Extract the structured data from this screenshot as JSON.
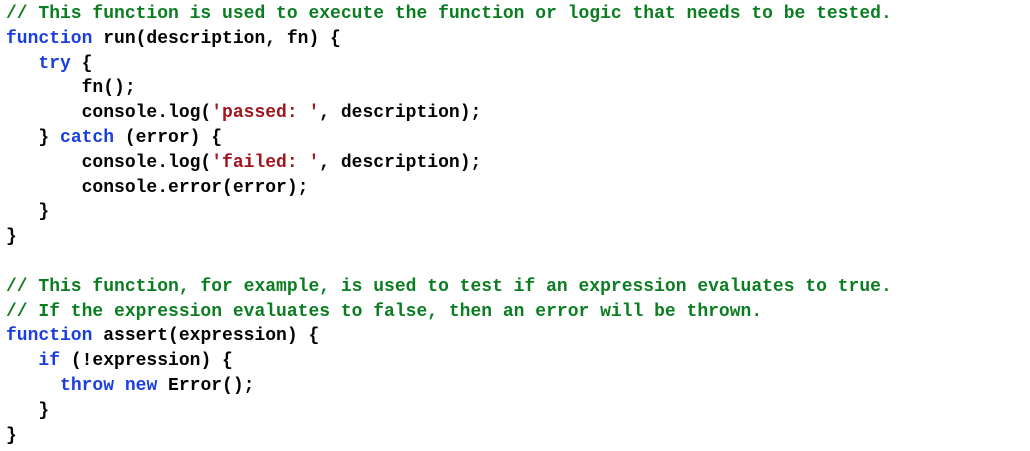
{
  "colors": {
    "comment": "#0a7d20",
    "keyword": "#1a3ee0",
    "string": "#a0141c",
    "text": "#000000",
    "background": "#ffffff"
  },
  "code": {
    "lines": [
      [
        {
          "t": "comment",
          "v": "// This function is used to execute the function or logic that needs to be tested."
        }
      ],
      [
        {
          "t": "keyword",
          "v": "function"
        },
        {
          "t": "plain",
          "v": " run(description, fn) {"
        }
      ],
      [
        {
          "t": "plain",
          "v": "   "
        },
        {
          "t": "keyword",
          "v": "try"
        },
        {
          "t": "plain",
          "v": " {"
        }
      ],
      [
        {
          "t": "plain",
          "v": "       fn();"
        }
      ],
      [
        {
          "t": "plain",
          "v": "       console.log("
        },
        {
          "t": "string",
          "v": "'passed: '"
        },
        {
          "t": "plain",
          "v": ", description);"
        }
      ],
      [
        {
          "t": "plain",
          "v": "   } "
        },
        {
          "t": "keyword",
          "v": "catch"
        },
        {
          "t": "plain",
          "v": " (error) {"
        }
      ],
      [
        {
          "t": "plain",
          "v": "       console.log("
        },
        {
          "t": "string",
          "v": "'failed: '"
        },
        {
          "t": "plain",
          "v": ", description);"
        }
      ],
      [
        {
          "t": "plain",
          "v": "       console.error(error);"
        }
      ],
      [
        {
          "t": "plain",
          "v": "   }"
        }
      ],
      [
        {
          "t": "plain",
          "v": "}"
        }
      ],
      [],
      [
        {
          "t": "comment",
          "v": "// This function, for example, is used to test if an expression evaluates to true."
        }
      ],
      [
        {
          "t": "comment",
          "v": "// If the expression evaluates to false, then an error will be thrown."
        }
      ],
      [
        {
          "t": "keyword",
          "v": "function"
        },
        {
          "t": "plain",
          "v": " assert(expression) {"
        }
      ],
      [
        {
          "t": "plain",
          "v": "   "
        },
        {
          "t": "keyword",
          "v": "if"
        },
        {
          "t": "plain",
          "v": " (!expression) {"
        }
      ],
      [
        {
          "t": "plain",
          "v": "     "
        },
        {
          "t": "keyword",
          "v": "throw"
        },
        {
          "t": "plain",
          "v": " "
        },
        {
          "t": "keyword",
          "v": "new"
        },
        {
          "t": "plain",
          "v": " Error();"
        }
      ],
      [
        {
          "t": "plain",
          "v": "   }"
        }
      ],
      [
        {
          "t": "plain",
          "v": "}"
        }
      ]
    ]
  }
}
